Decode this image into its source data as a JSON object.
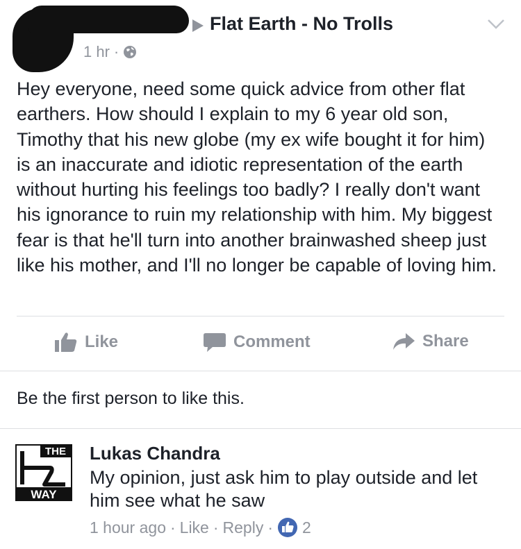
{
  "post": {
    "group_name": "Flat Earth - No Trolls",
    "time": "1 hr",
    "separator": "·",
    "text": "Hey everyone, need some quick advice from other flat earthers. How should I explain to my 6 year old son, Timothy that his new globe (my ex wife bought it for him) is an inaccurate and idiotic representation of the earth without hurting his feelings too badly? I really don't want his ignorance to ruin my relationship with him. My biggest fear is that he'll turn into another brainwashed sheep just like his mother, and I'll no longer be capable of loving him."
  },
  "actions": {
    "like": "Like",
    "comment": "Comment",
    "share": "Share"
  },
  "likes_summary": "Be the first person to like this.",
  "comment": {
    "avatar_top": "THE",
    "avatar_bottom": "WAY",
    "author": "Lukas Chandra",
    "text": "My opinion, just ask him to play outside and let him see what he saw",
    "time": "1 hour ago",
    "like": "Like",
    "reply": "Reply",
    "separator": "·",
    "like_count": "2"
  },
  "colors": {
    "text": "#1d2129",
    "meta": "#90949c",
    "facebook_blue": "#4267b2",
    "divider": "#dddfe2"
  },
  "icons": [
    "globe-icon",
    "chevron-down-icon",
    "like-icon",
    "comment-icon",
    "share-icon",
    "play-arrow-icon"
  ]
}
